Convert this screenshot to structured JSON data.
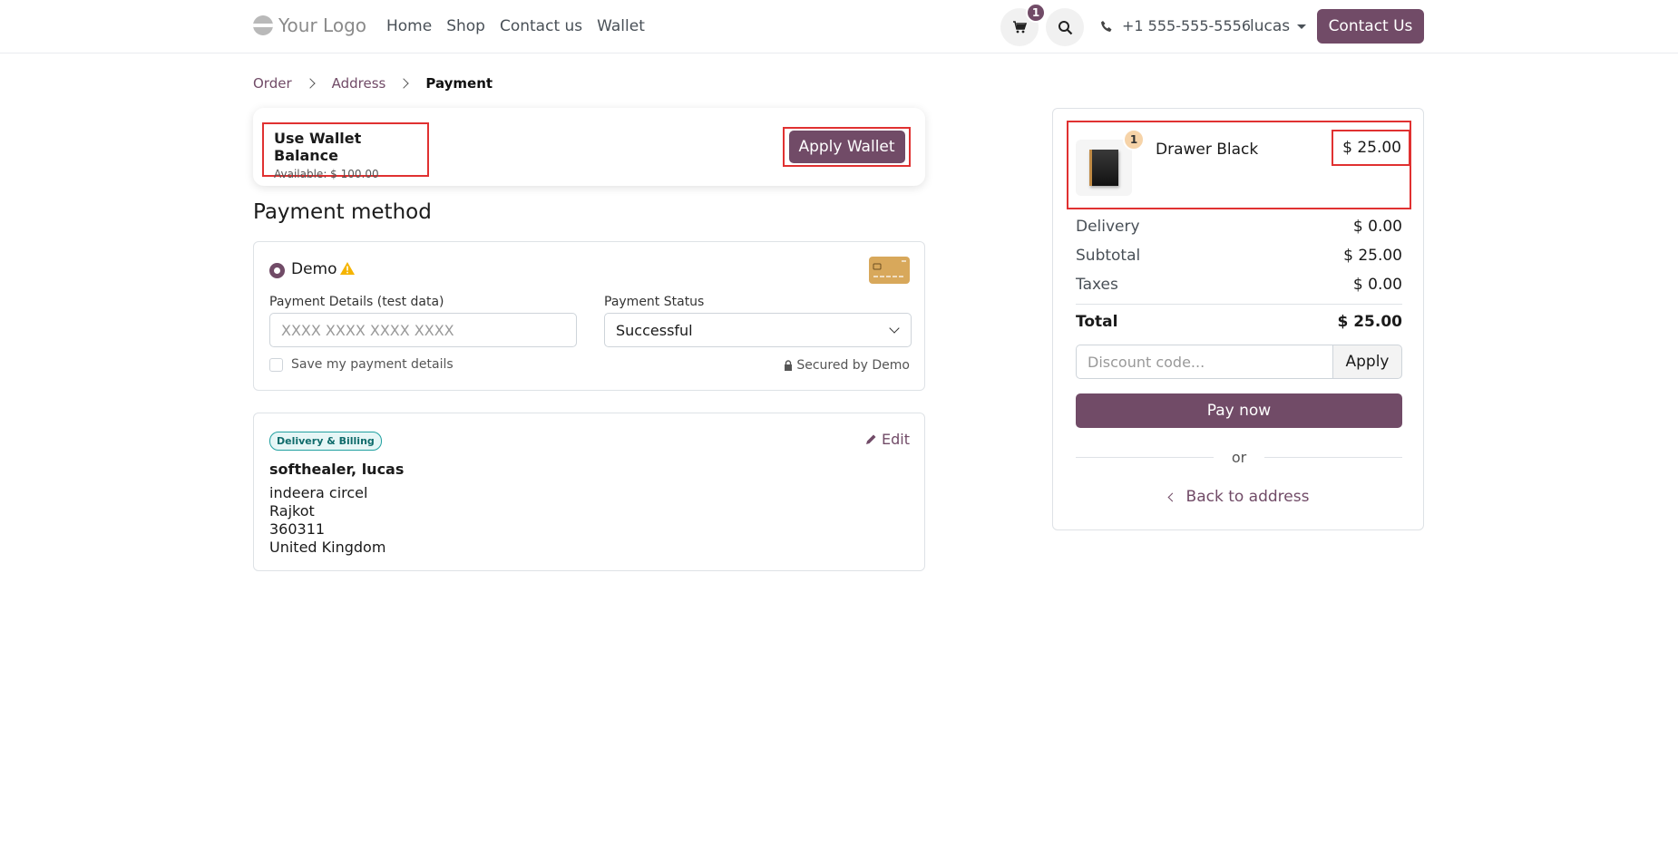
{
  "header": {
    "logo_text": "Your Logo",
    "nav": [
      "Home",
      "Shop",
      "Contact us",
      "Wallet"
    ],
    "cart_count": "1",
    "phone": "+1 555-555-5556",
    "user": "lucas",
    "contact_button": "Contact Us"
  },
  "breadcrumb": {
    "step1": "Order",
    "step2": "Address",
    "step3": "Payment"
  },
  "wallet": {
    "title": "Use Wallet Balance",
    "available": "Available: $ 100.00",
    "apply_button": "Apply Wallet"
  },
  "payment": {
    "section_title": "Payment method",
    "method_label": "Demo",
    "details_label": "Payment Details (test data)",
    "details_placeholder": "XXXX XXXX XXXX XXXX",
    "status_label": "Payment Status",
    "status_value": "Successful",
    "save_label": "Save my payment details",
    "secured": "Secured by Demo"
  },
  "address": {
    "badge": "Delivery & Billing",
    "edit": "Edit",
    "name": "softhealer, lucas",
    "lines": [
      "indeera circel",
      "Rajkot",
      "360311",
      "United Kingdom"
    ]
  },
  "summary": {
    "product": {
      "name": "Drawer Black",
      "price": "$ 25.00",
      "qty": "1"
    },
    "rows": [
      {
        "label": "Delivery",
        "value": "$ 0.00"
      },
      {
        "label": "Subtotal",
        "value": "$ 25.00"
      },
      {
        "label": "Taxes",
        "value": "$ 0.00"
      }
    ],
    "total_label": "Total",
    "total_value": "$ 25.00",
    "discount_placeholder": "Discount code...",
    "discount_button": "Apply",
    "pay_button": "Pay now",
    "or": "or",
    "back": "Back to address"
  },
  "colors": {
    "primary": "#714b67",
    "highlight": "#e03131"
  }
}
